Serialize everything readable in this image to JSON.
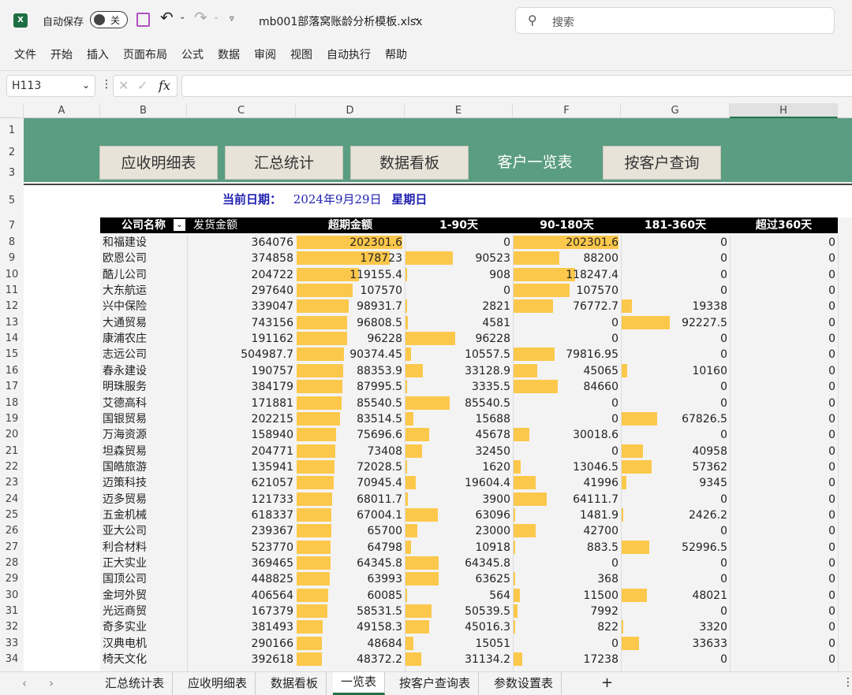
{
  "app": {
    "autosave_label": "自动保存",
    "autosave_state": "关",
    "filename": "mb001部落窝账龄分析模板.xlsx",
    "search_placeholder": "搜索"
  },
  "menu": [
    "文件",
    "开始",
    "插入",
    "页面布局",
    "公式",
    "数据",
    "审阅",
    "视图",
    "自动执行",
    "帮助"
  ],
  "formula_bar": {
    "name_box": "H113",
    "formula": ""
  },
  "columns": [
    "A",
    "B",
    "C",
    "D",
    "E",
    "F",
    "G",
    "H"
  ],
  "nav_buttons": [
    {
      "label": "应收明细表"
    },
    {
      "label": "汇总统计"
    },
    {
      "label": "数据看板"
    },
    {
      "label": "客户一览表",
      "active": true
    },
    {
      "label": "按客户查询"
    }
  ],
  "date_line": {
    "label": "当前日期：",
    "date": "2024年9月29日",
    "weekday": "星期日"
  },
  "table": {
    "headers": [
      "公司名称",
      "发货金额",
      "超期金额",
      "1-90天",
      "90-180天",
      "181-360天",
      "超过360天"
    ],
    "row_numbers": [
      8,
      9,
      10,
      11,
      12,
      13,
      14,
      15,
      16,
      17,
      18,
      19,
      20,
      21,
      22,
      23,
      24,
      25,
      26,
      27,
      28,
      29,
      30,
      31,
      32,
      33,
      34
    ],
    "rows": [
      [
        "和福建设",
        "364076",
        "202301.6",
        "0",
        "202301.6",
        "0",
        "0"
      ],
      [
        "欧恩公司",
        "374858",
        "178723",
        "90523",
        "88200",
        "0",
        "0"
      ],
      [
        "酷儿公司",
        "204722",
        "119155.4",
        "908",
        "118247.4",
        "0",
        "0"
      ],
      [
        "大东航运",
        "297640",
        "107570",
        "0",
        "107570",
        "0",
        "0"
      ],
      [
        "兴中保险",
        "339047",
        "98931.7",
        "2821",
        "76772.7",
        "19338",
        "0"
      ],
      [
        "大通贸易",
        "743156",
        "96808.5",
        "4581",
        "0",
        "92227.5",
        "0"
      ],
      [
        "康浦农庄",
        "191162",
        "96228",
        "96228",
        "0",
        "0",
        "0"
      ],
      [
        "志远公司",
        "504987.7",
        "90374.45",
        "10557.5",
        "79816.95",
        "0",
        "0"
      ],
      [
        "春永建设",
        "190757",
        "88353.9",
        "33128.9",
        "45065",
        "10160",
        "0"
      ],
      [
        "明珠服务",
        "384179",
        "87995.5",
        "3335.5",
        "84660",
        "0",
        "0"
      ],
      [
        "艾德高科",
        "171881",
        "85540.5",
        "85540.5",
        "0",
        "0",
        "0"
      ],
      [
        "国银贸易",
        "202215",
        "83514.5",
        "15688",
        "0",
        "67826.5",
        "0"
      ],
      [
        "万海资源",
        "158940",
        "75696.6",
        "45678",
        "30018.6",
        "0",
        "0"
      ],
      [
        "坦森贸易",
        "204771",
        "73408",
        "32450",
        "0",
        "40958",
        "0"
      ],
      [
        "国皓旅游",
        "135941",
        "72028.5",
        "1620",
        "13046.5",
        "57362",
        "0"
      ],
      [
        "迈策科技",
        "621057",
        "70945.4",
        "19604.4",
        "41996",
        "9345",
        "0"
      ],
      [
        "迈多贸易",
        "121733",
        "68011.7",
        "3900",
        "64111.7",
        "0",
        "0"
      ],
      [
        "五金机械",
        "618337",
        "67004.1",
        "63096",
        "1481.9",
        "2426.2",
        "0"
      ],
      [
        "亚大公司",
        "239367",
        "65700",
        "23000",
        "42700",
        "0",
        "0"
      ],
      [
        "利合材料",
        "523770",
        "64798",
        "10918",
        "883.5",
        "52996.5",
        "0"
      ],
      [
        "正大实业",
        "369465",
        "64345.8",
        "64345.8",
        "0",
        "0",
        "0"
      ],
      [
        "国顶公司",
        "448825",
        "63993",
        "63625",
        "368",
        "0",
        "0"
      ],
      [
        "金坷外贸",
        "406564",
        "60085",
        "564",
        "11500",
        "48021",
        "0"
      ],
      [
        "光远商贸",
        "167379",
        "58531.5",
        "50539.5",
        "7992",
        "0",
        "0"
      ],
      [
        "奇多实业",
        "381493",
        "49158.3",
        "45016.3",
        "822",
        "3320",
        "0"
      ],
      [
        "汉典电机",
        "290166",
        "48684",
        "15051",
        "0",
        "33633",
        "0"
      ],
      [
        "椅天文化",
        "392618",
        "48372.2",
        "31134.2",
        "17238",
        "0",
        "0"
      ]
    ]
  },
  "sheet_tabs": [
    {
      "label": "汇总统计表"
    },
    {
      "label": "应收明细表"
    },
    {
      "label": "数据看板"
    },
    {
      "label": "一览表",
      "active": true
    },
    {
      "label": "按客户查询表"
    },
    {
      "label": "参数设置表"
    }
  ],
  "colors": {
    "banner": "#5a9d82",
    "bar": "#fcc84b",
    "header_bg": "#000000",
    "date_text": "#1f1fb0",
    "active_tab": "#217346"
  }
}
